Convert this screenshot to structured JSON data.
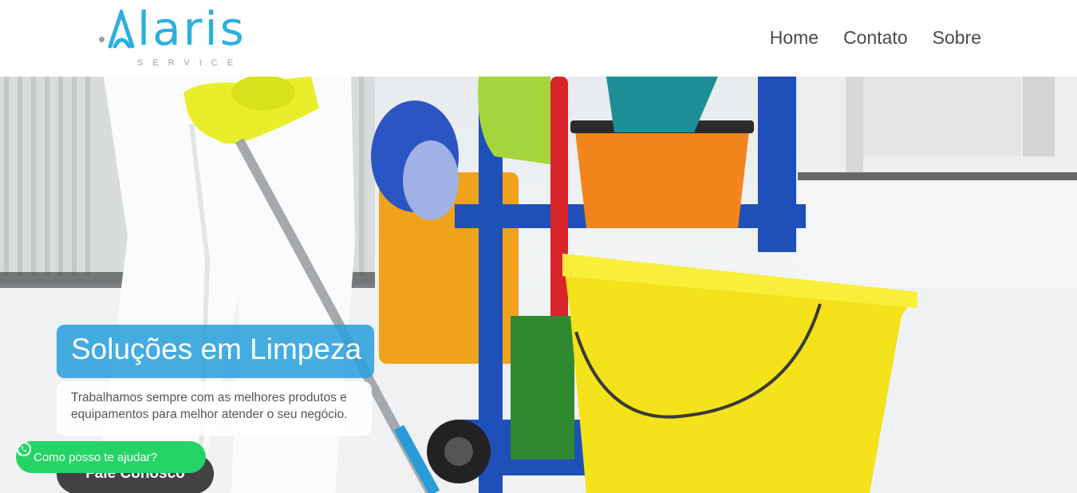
{
  "brand": {
    "name": "laris",
    "tagline": "SERVICE"
  },
  "nav": {
    "items": [
      "Home",
      "Contato",
      "Sobre"
    ]
  },
  "hero": {
    "title": "Soluções em Limpeza",
    "description": "Trabalhamos sempre com as melhores produtos e equipamentos para melhor atender o seu negócio.",
    "cta_label": "Fale Conosco",
    "cta_icon": "wechat-icon"
  },
  "whatsapp": {
    "label": "Como posso te ajudar?",
    "icon": "whatsapp-icon"
  },
  "colors": {
    "brand": "#2bb0e0",
    "title_bg": "#2ba0dc",
    "cta_bg": "#424242",
    "whatsapp": "#25d366"
  }
}
